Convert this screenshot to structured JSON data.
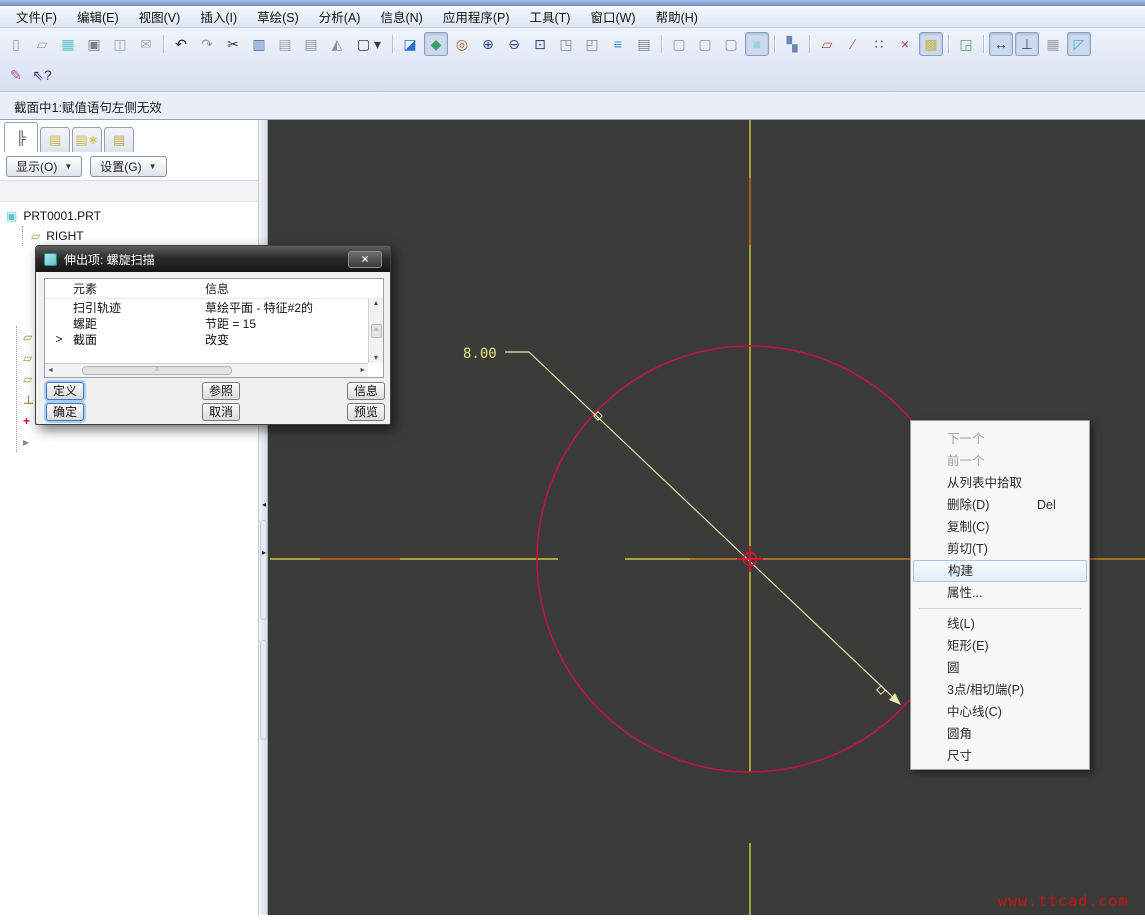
{
  "menubar": {
    "items": [
      {
        "name": "menu-file",
        "label": "文件(F)"
      },
      {
        "name": "menu-edit",
        "label": "编辑(E)"
      },
      {
        "name": "menu-view",
        "label": "视图(V)"
      },
      {
        "name": "menu-insert",
        "label": "插入(I)"
      },
      {
        "name": "menu-sketch",
        "label": "草绘(S)"
      },
      {
        "name": "menu-analysis",
        "label": "分析(A)"
      },
      {
        "name": "menu-info",
        "label": "信息(N)"
      },
      {
        "name": "menu-applications",
        "label": "应用程序(P)"
      },
      {
        "name": "menu-tools",
        "label": "工具(T)"
      },
      {
        "name": "menu-window",
        "label": "窗口(W)"
      },
      {
        "name": "menu-help",
        "label": "帮助(H)"
      }
    ]
  },
  "toolbar": {
    "row1": [
      {
        "name": "new-file",
        "glyph": "▯",
        "color": "#93a0b4"
      },
      {
        "name": "open",
        "glyph": "▱",
        "color": "#a9a18c"
      },
      {
        "name": "save",
        "glyph": "▦",
        "color": "#5fc0c8"
      },
      {
        "name": "print",
        "glyph": "▣",
        "color": "#77828f"
      },
      {
        "name": "save-a-copy",
        "glyph": "◫",
        "color": "#9aa2ad"
      },
      {
        "name": "email-link",
        "glyph": "✉",
        "color": "#a6adb8"
      },
      {
        "sep": true
      },
      {
        "name": "undo",
        "glyph": "↶",
        "color": "#1c1c1c"
      },
      {
        "name": "redo",
        "glyph": "↷",
        "color": "#9a9a9a"
      },
      {
        "name": "cut",
        "glyph": "✂",
        "color": "#27354f"
      },
      {
        "name": "copy",
        "glyph": "▥",
        "color": "#3c6cb0"
      },
      {
        "name": "paste",
        "glyph": "▤",
        "color": "#9aa2aa"
      },
      {
        "name": "paste-special",
        "glyph": "▤",
        "color": "#8b939b"
      },
      {
        "name": "find",
        "glyph": "◭",
        "color": "#8d929a"
      },
      {
        "name": "selection-filter",
        "glyph": "▢ ▾",
        "color": "#3a3a3a",
        "wide": true
      },
      {
        "sep": true
      },
      {
        "name": "repaint",
        "glyph": "◪",
        "color": "#2e6ecf"
      },
      {
        "name": "datum-display",
        "glyph": "◆",
        "color": "#37a066",
        "pressed": true
      },
      {
        "name": "spin-center",
        "glyph": "◎",
        "color": "#b05a2a"
      },
      {
        "name": "zoom-in",
        "glyph": "⊕",
        "color": "#32497f"
      },
      {
        "name": "zoom-out",
        "glyph": "⊖",
        "color": "#32497f"
      },
      {
        "name": "zoom-refit",
        "glyph": "⊡",
        "color": "#32497f"
      },
      {
        "name": "reorient",
        "glyph": "◳",
        "color": "#7d8896"
      },
      {
        "name": "annotation",
        "glyph": "◰",
        "color": "#7d8896"
      },
      {
        "name": "layers",
        "glyph": "≡",
        "color": "#3f93cf"
      },
      {
        "name": "view-manager",
        "glyph": "▤",
        "color": "#76808a"
      },
      {
        "sep": true
      },
      {
        "name": "wireframe",
        "glyph": "▢",
        "color": "#8b929b"
      },
      {
        "name": "hidden-line",
        "glyph": "▢",
        "color": "#8b929b"
      },
      {
        "name": "no-hidden-line",
        "glyph": "▢",
        "color": "#8b929b"
      },
      {
        "name": "shaded",
        "glyph": "■",
        "color": "#9ad4d8",
        "pressed": true
      },
      {
        "sep": true
      },
      {
        "name": "model-tree-toggle",
        "glyph": "▚",
        "color": "#6a86b8"
      },
      {
        "sep": true
      },
      {
        "name": "plane-display",
        "glyph": "▱",
        "color": "#b0584a"
      },
      {
        "name": "axis-display",
        "glyph": "∕",
        "color": "#b0584a"
      },
      {
        "name": "point-display",
        "glyph": "∷",
        "color": "#8d4a3e"
      },
      {
        "name": "csys-display",
        "glyph": "×",
        "color": "#8d4a3e"
      },
      {
        "name": "plane-tag-display",
        "glyph": "▩",
        "color": "#c6b648",
        "pressed": true
      },
      {
        "sep": true
      },
      {
        "name": "sketch-orient",
        "glyph": "◲",
        "color": "#5f9c74"
      },
      {
        "sep": true
      },
      {
        "name": "dimension-display",
        "glyph": "↔",
        "color": "#3c3c3c",
        "pressed": true
      },
      {
        "name": "constraint-display",
        "glyph": "⊥",
        "color": "#44507c",
        "pressed": true
      },
      {
        "name": "grid-display",
        "glyph": "▦",
        "color": "#98a0a8"
      },
      {
        "name": "vertex-display",
        "glyph": "◸",
        "color": "#4fb0c8",
        "pressed": true
      }
    ],
    "row2": [
      {
        "name": "sketcher-tool",
        "glyph": "✎",
        "color": "#b04ab0"
      },
      {
        "name": "context-help",
        "glyph": "⇖?",
        "color": "#4a2a7a"
      }
    ]
  },
  "message_bar": {
    "text": "截面中1:赋值语句左侧无效"
  },
  "left_panel": {
    "tabs": [
      {
        "name": "model-tree-tab",
        "glyph": "╠",
        "color": "#3a3a3a",
        "active": true
      },
      {
        "name": "folder-browser-tab",
        "glyph": "▤",
        "color": "#d8b84e"
      },
      {
        "name": "favorites-tab",
        "glyph": "▤∗",
        "color": "#d8b84e"
      },
      {
        "name": "connections-tab",
        "glyph": "▤",
        "color": "#c9a23e"
      }
    ],
    "show_button": {
      "label": "显示(O)",
      "arrow": "▼"
    },
    "settings_button": {
      "label": "设置(G)",
      "arrow": "▼"
    },
    "tree": {
      "root": {
        "glyph": "▣",
        "color": "#5ec4cc",
        "label": "PRT0001.PRT"
      },
      "right": {
        "glyph": "▱",
        "color": "#b08c50",
        "label": "RIGHT"
      },
      "hidden_icons": [
        {
          "name": "datum-plane",
          "glyph": "▱",
          "color": "#b08c50"
        },
        {
          "name": "datum-plane",
          "glyph": "▱",
          "color": "#b08c50"
        },
        {
          "name": "datum-plane",
          "glyph": "▱",
          "color": "#b08c50"
        },
        {
          "name": "csys",
          "glyph": "⊥",
          "color": "#b08c50"
        },
        {
          "name": "insert-marker",
          "glyph": "+",
          "color": "#d01030"
        },
        {
          "name": "feature",
          "glyph": "▸",
          "color": "#8a8a8a"
        }
      ]
    }
  },
  "splitter": {
    "collapse_left": "◂",
    "collapse_right": "▸"
  },
  "dialog": {
    "title": "伸出项: 螺旋扫描",
    "close": "×",
    "columns": {
      "element": "元素",
      "info": "信息"
    },
    "rows": [
      {
        "sel": "",
        "element": "扫引轨迹",
        "info": "草绘平面 - 特征#2的"
      },
      {
        "sel": "",
        "element": "螺距",
        "info": "节距 = 15"
      },
      {
        "sel": ">",
        "element": "截面",
        "info": "改变"
      }
    ],
    "scroll": {
      "up": "▲",
      "down": "▼",
      "left": "◄",
      "right": "►",
      "vthumb": "≡",
      "hthumb": "≡"
    },
    "buttons": {
      "define": "定义",
      "refs": "参照",
      "info": "信息",
      "ok": "确定",
      "cancel": "取消",
      "preview": "预览"
    }
  },
  "context_menu": {
    "items": [
      {
        "name": "next",
        "label": "下一个",
        "disabled": true
      },
      {
        "name": "previous",
        "label": "前一个",
        "disabled": true
      },
      {
        "name": "pick-from-list",
        "label": "从列表中拾取"
      },
      {
        "name": "delete",
        "label": "删除(D)",
        "shortcut": "Del"
      },
      {
        "name": "copy",
        "label": "复制(C)"
      },
      {
        "name": "cut",
        "label": "剪切(T)"
      },
      {
        "name": "construct",
        "label": "构建",
        "highlighted": true
      },
      {
        "name": "properties",
        "label": "属性..."
      },
      {
        "separator": true
      },
      {
        "name": "line",
        "label": "线(L)"
      },
      {
        "name": "rectangle",
        "label": "矩形(E)"
      },
      {
        "name": "circle",
        "label": "圆"
      },
      {
        "name": "three-point-tangent",
        "label": "3点/相切端(P)"
      },
      {
        "name": "centerline",
        "label": "中心线(C)"
      },
      {
        "name": "fillet",
        "label": "圆角"
      },
      {
        "name": "dimension",
        "label": "尺寸"
      }
    ]
  },
  "canvas": {
    "dimension_label": "8.00",
    "background": "#3b3b39",
    "circle_color": "#c01446",
    "centerline_color": "#e8e73f",
    "reference_color": "#b85c16",
    "entity_color": "#e6e6aa",
    "dim_text_color": "#e6e67e",
    "marker_color": "#d81238"
  },
  "watermark": {
    "text": "www.ttcad.com",
    "color": "#cc1111"
  }
}
